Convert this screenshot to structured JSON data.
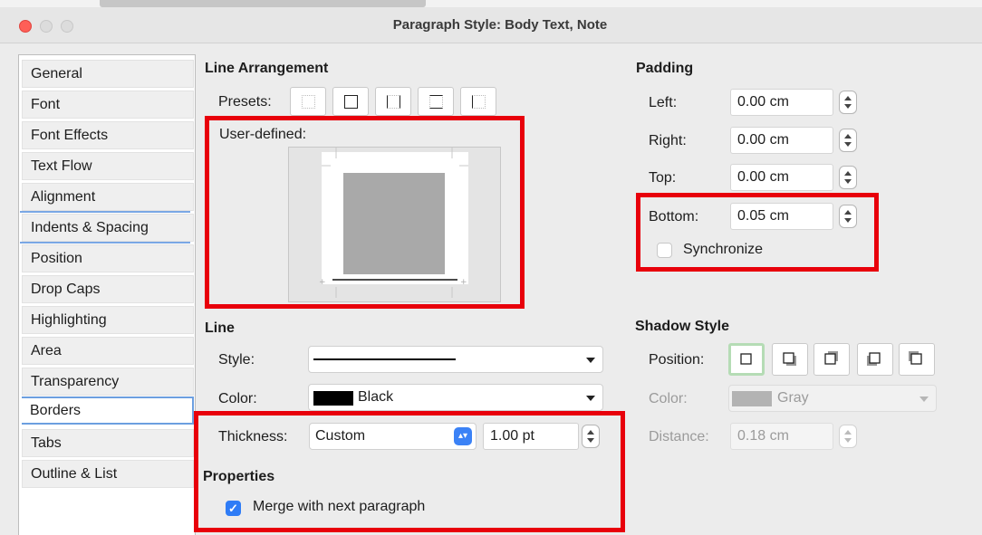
{
  "window": {
    "title": "Paragraph Style: Body Text, Note"
  },
  "colors": {
    "highlight_red": "#e8000b",
    "accent_blue": "#2f7cf6",
    "black_swatch": "#000000",
    "gray_swatch": "#b3b3b3"
  },
  "sidebar": {
    "tabs": [
      {
        "label": "General"
      },
      {
        "label": "Font"
      },
      {
        "label": "Font Effects"
      },
      {
        "label": "Text Flow"
      },
      {
        "label": "Alignment"
      },
      {
        "label": "Indents & Spacing"
      },
      {
        "label": "Position"
      },
      {
        "label": "Drop Caps"
      },
      {
        "label": "Highlighting"
      },
      {
        "label": "Area"
      },
      {
        "label": "Transparency"
      },
      {
        "label": "Borders",
        "selected": true
      },
      {
        "label": "Tabs"
      },
      {
        "label": "Outline & List"
      }
    ]
  },
  "line_arrangement": {
    "heading": "Line Arrangement",
    "presets_label": "Presets:",
    "presets": [
      "none-border-icon",
      "all-borders-icon",
      "left-right-borders-icon",
      "top-bottom-borders-icon",
      "left-border-icon"
    ],
    "user_defined_label": "User-defined:"
  },
  "line": {
    "heading": "Line",
    "style_label": "Style:",
    "color_label": "Color:",
    "color_value": "Black",
    "thickness_label": "Thickness:",
    "thickness_value": "Custom",
    "thickness_amount": "1.00 pt"
  },
  "properties": {
    "heading": "Properties",
    "merge_label": "Merge with next paragraph",
    "merge_checked": true
  },
  "padding": {
    "heading": "Padding",
    "left_label": "Left:",
    "left_value": "0.00 cm",
    "right_label": "Right:",
    "right_value": "0.00 cm",
    "top_label": "Top:",
    "top_value": "0.00 cm",
    "bottom_label": "Bottom:",
    "bottom_value": "0.05 cm",
    "synchronize_label": "Synchronize",
    "synchronize_checked": false
  },
  "shadow": {
    "heading": "Shadow Style",
    "position_label": "Position:",
    "positions": [
      "no-shadow-icon",
      "shadow-bottom-right-icon",
      "shadow-top-right-icon",
      "shadow-bottom-left-icon",
      "shadow-top-left-icon"
    ],
    "color_label": "Color:",
    "color_value": "Gray",
    "distance_label": "Distance:",
    "distance_value": "0.18 cm"
  }
}
